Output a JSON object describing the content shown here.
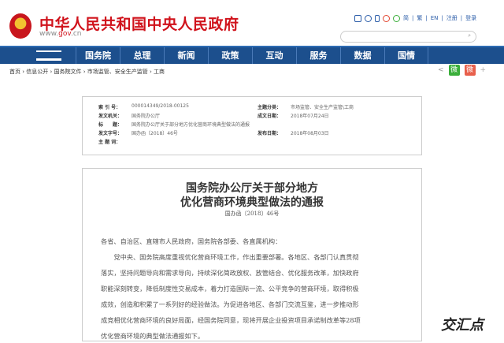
{
  "header": {
    "title": "中华人民共和国中央人民政府",
    "url_prefix": "www.",
    "url_brand": "gov",
    "url_suffix": ".cn",
    "links": [
      "简",
      "繁",
      "EN",
      "注册",
      "登录"
    ],
    "search_placeholder": "",
    "search_icon": "⌕"
  },
  "nav": [
    "国务院",
    "总理",
    "新闻",
    "政策",
    "互动",
    "服务",
    "数据",
    "国情"
  ],
  "breadcrumb": [
    "首页",
    "信息公开",
    "国务院文件",
    "市场监管、安全生产监管",
    "工商"
  ],
  "share": {
    "share_icon": "share-icon",
    "wechat": "微",
    "weibo": "微",
    "plus": "+"
  },
  "info": {
    "index_label": "索 引 号：",
    "index": "000014349/2018-00125",
    "topic_label": "主题分类：",
    "topic": "市场监管、安全生产监管\\工商",
    "issuer_label": "发文机关：",
    "issuer": "国务院办公厅",
    "date_label": "成文日期：",
    "date": "2018年07月24日",
    "title_label": "标　　题：",
    "title": "国务院办公厅关于部分地方优化营商环境典型做法的通报",
    "docno_label": "发文字号：",
    "docno": "国办函〔2018〕46号",
    "pub_label": "发布日期：",
    "pub": "2018年08月03日",
    "kw_label": "主 题 词："
  },
  "doc": {
    "title1": "国务院办公厅关于部分地方",
    "title2": "优化营商环境典型做法的通报",
    "docno": "国办函〔2018〕46号",
    "salutation": "各省、自治区、直辖市人民政府，国务院各部委、各直属机构：",
    "lines": [
      "　　党中央、国务院高度重视优化营商环境工作，作出重要部署。各地区、各部门认真贯彻",
      "落实，坚持问题导向和需求导向，持续深化简政放权、放管结合、优化服务改革，加快政府",
      "职能深刻转变，降低制度性交易成本，着力打造国际一流、公平竞争的营商环境，取得积极",
      "成效，创造和积累了一系列好的经验做法。为促进各地区、各部门交流互鉴，进一步推动形",
      "成竞相优化营商环境的良好局面，经国务院同意，现将开展企业投资项目承诺制改革等28项",
      "优化营商环境的典型做法通报如下。"
    ]
  },
  "watermark": "交汇点"
}
